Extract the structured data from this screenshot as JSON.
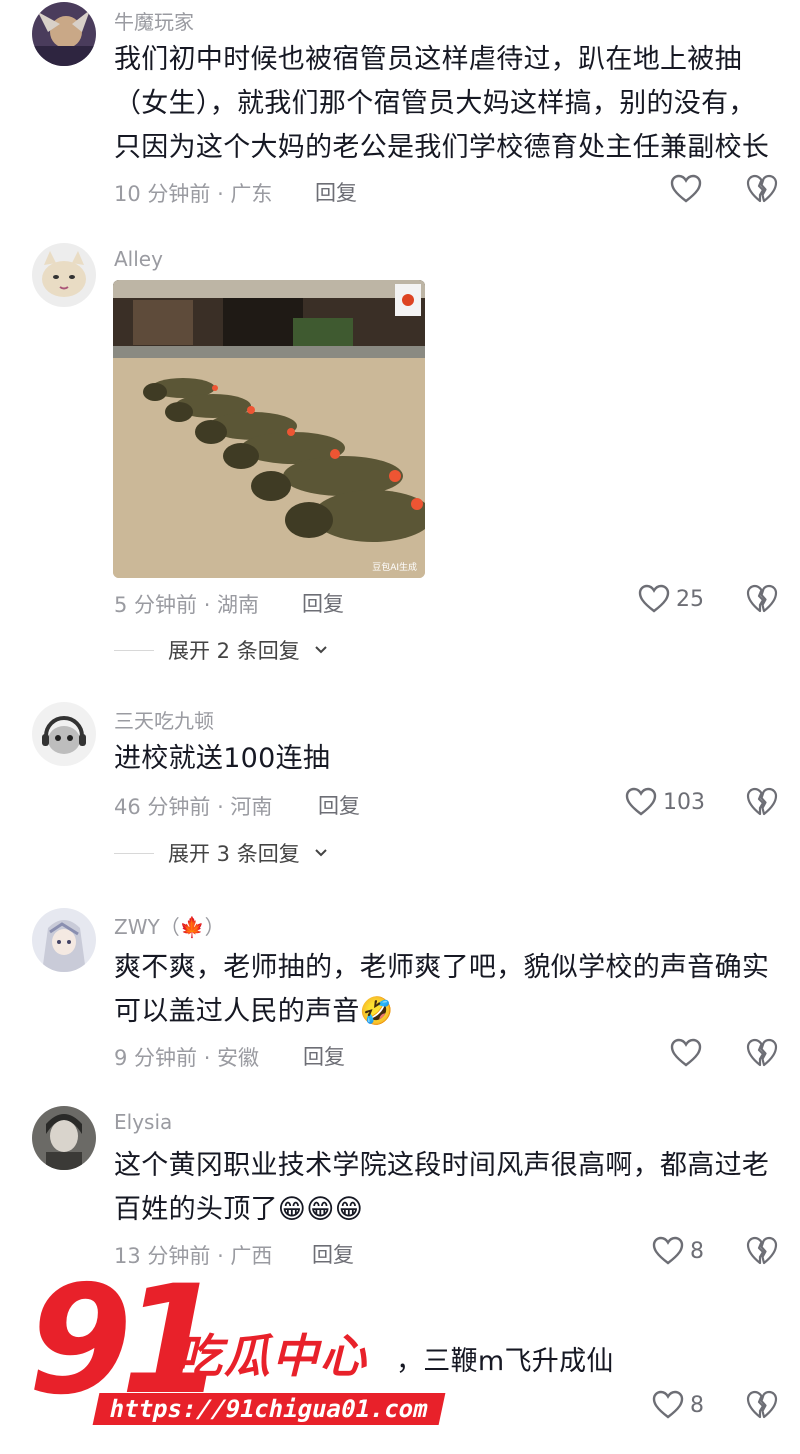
{
  "reply_label": "回复",
  "comments": [
    {
      "username": "牛魔玩家",
      "lines": [
        "我们初中时候也被宿管员这样虐待过，趴在地上被抽",
        "（女生），就我们那个宿管员大妈这样搞，别的没有，",
        "只因为这个大妈的老公是我们学校德育处主任兼副校长"
      ],
      "time_location": "10 分钟前 · 广东",
      "likes": ""
    },
    {
      "username": "Alley",
      "image_caption": "豆包AI生成",
      "time_location": "5 分钟前 · 湖南",
      "likes": "25",
      "expand": "展开 2 条回复"
    },
    {
      "username": "三天吃九顿",
      "lines": [
        "进校就送100连抽"
      ],
      "time_location": "46 分钟前 · 河南",
      "likes": "103",
      "expand": "展开 3 条回复"
    },
    {
      "username": "ZWY（🍁）",
      "lines": [
        "爽不爽，老师抽的，老师爽了吧，貌似学校的声音确实",
        "可以盖过人民的声音🤣"
      ],
      "time_location": "9 分钟前 · 安徽",
      "likes": ""
    },
    {
      "username": "Elysia",
      "lines": [
        "这个黄冈职业技术学院这段时间风声很高啊，都高过老",
        "百姓的头顶了😁😁😁"
      ],
      "time_location": "13 分钟前 · 广西",
      "likes": "8"
    },
    {
      "username": "",
      "lines": [
        "，三鞭m飞升成仙"
      ],
      "time_location": "",
      "likes": "8"
    }
  ],
  "watermark": {
    "number": "91",
    "title": "吃瓜中心",
    "url": "https://91chigua01.com"
  },
  "colors": {
    "accent_red": "#e8212a",
    "meta_gray": "#9a9ba1"
  }
}
